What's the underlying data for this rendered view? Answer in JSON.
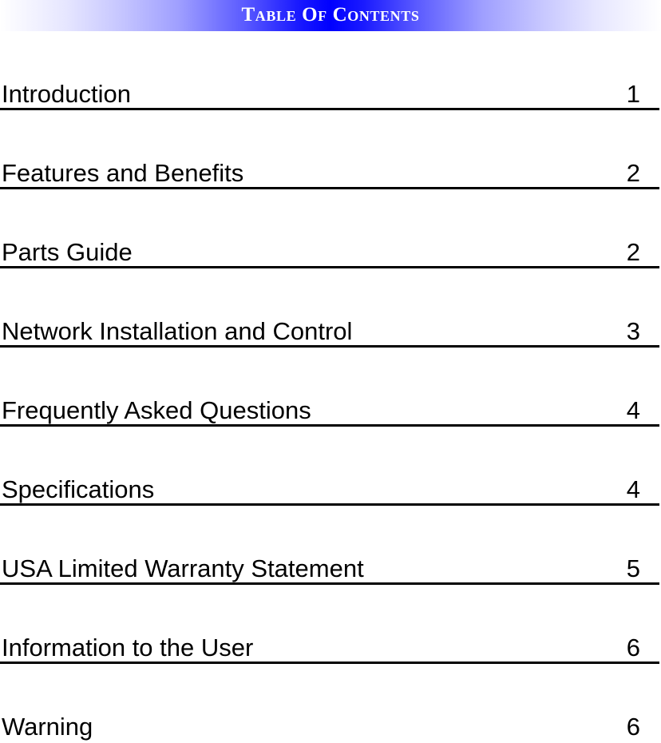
{
  "header": {
    "title": "Table Of Contents",
    "band_gradient_center_color": "#0000ff",
    "band_gradient_edge_color": "#ffffff",
    "title_color": "#ffffff"
  },
  "toc": {
    "rule_color": "#000000",
    "entries": [
      {
        "label": "Introduction",
        "page": "1",
        "has_rule": true
      },
      {
        "label": "Features and Benefits",
        "page": "2",
        "has_rule": true
      },
      {
        "label": "Parts Guide",
        "page": "2",
        "has_rule": true
      },
      {
        "label": "Network Installation and Control",
        "page": "3",
        "has_rule": true
      },
      {
        "label": "Frequently Asked Questions",
        "page": "4",
        "has_rule": true
      },
      {
        "label": "Specifications",
        "page": "4",
        "has_rule": true
      },
      {
        "label": "USA Limited Warranty Statement",
        "page": "5",
        "has_rule": true
      },
      {
        "label": "Information to the User",
        "page": "6",
        "has_rule": true
      },
      {
        "label": "Warning",
        "page": "6",
        "has_rule": false
      }
    ]
  }
}
